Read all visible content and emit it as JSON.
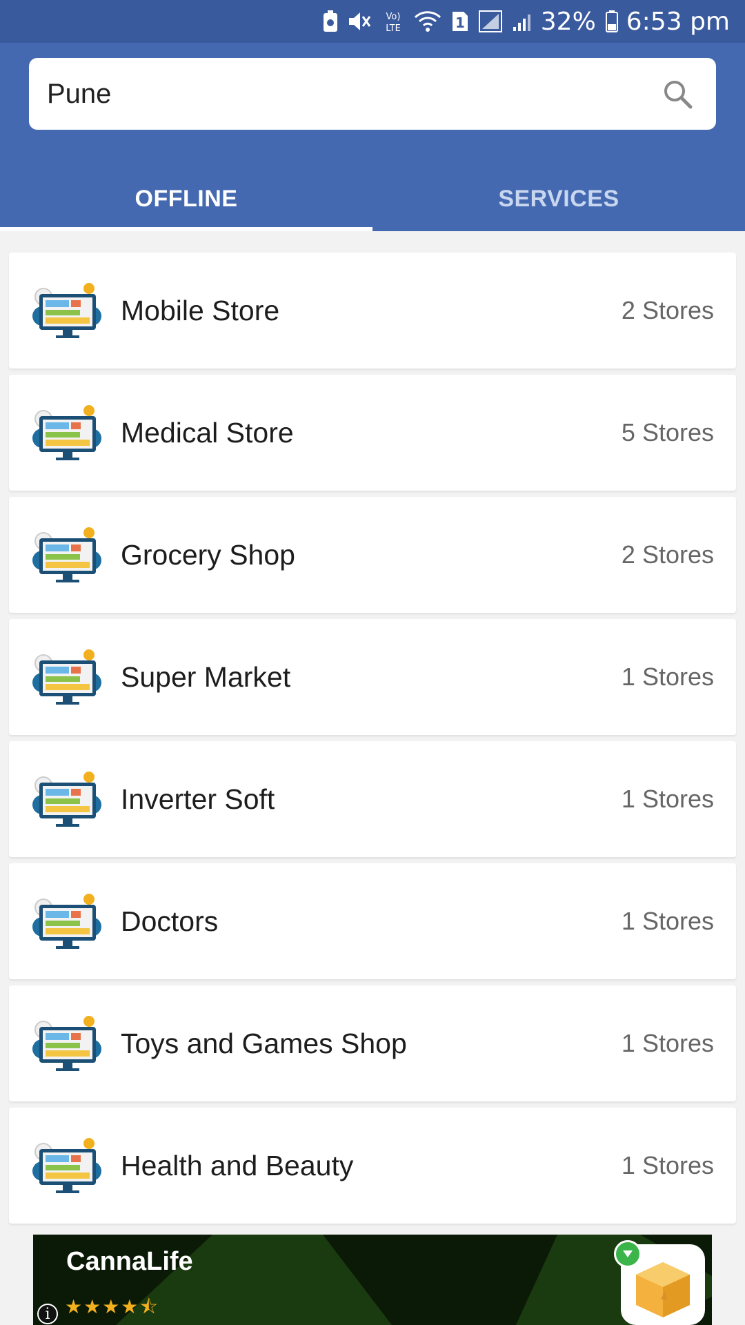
{
  "status_bar": {
    "battery_percent": "32%",
    "time": "6:53 pm",
    "icons": [
      "battery-saver-icon",
      "mute-icon",
      "volte-icon",
      "wifi-icon",
      "sim1-icon",
      "signal-icon",
      "signal-icon-2",
      "battery-icon"
    ],
    "volte_label": "Vo) LTE",
    "sim_label": "1"
  },
  "search": {
    "value": "Pune",
    "icon": "search-icon"
  },
  "tabs": [
    {
      "label": "OFFLINE",
      "active": true
    },
    {
      "label": "SERVICES",
      "active": false
    }
  ],
  "categories": [
    {
      "name": "Mobile Store",
      "count": "2 Stores",
      "icon": "category-icon"
    },
    {
      "name": "Medical Store",
      "count": "5 Stores",
      "icon": "category-icon"
    },
    {
      "name": "Grocery Shop",
      "count": "2 Stores",
      "icon": "category-icon"
    },
    {
      "name": "Super Market",
      "count": "1 Stores",
      "icon": "category-icon"
    },
    {
      "name": "Inverter Soft",
      "count": "1 Stores",
      "icon": "category-icon"
    },
    {
      "name": "Doctors",
      "count": "1 Stores",
      "icon": "category-icon"
    },
    {
      "name": "Toys and Games Shop",
      "count": "1 Stores",
      "icon": "category-icon"
    },
    {
      "name": "Health and Beauty",
      "count": "1 Stores",
      "icon": "category-icon"
    }
  ],
  "ad": {
    "title": "CannaLife",
    "rating": 4.5,
    "stars": "★★★★⯪",
    "info_glyph": "i"
  },
  "colors": {
    "status_bar": "#3a5a9e",
    "header": "#4469b0",
    "tab_active": "#ffffff",
    "tab_inactive": "#c9d6ef",
    "ad_background": "#1a3a10",
    "star": "#f2b01e"
  }
}
